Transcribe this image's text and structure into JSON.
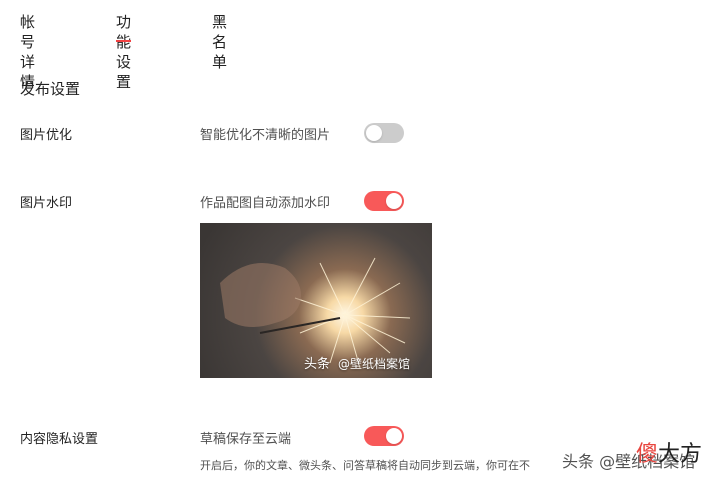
{
  "tabs": [
    {
      "label": "帐号详情",
      "active": false
    },
    {
      "label": "功能设置",
      "active": true
    },
    {
      "label": "黑名单",
      "active": false
    }
  ],
  "section": {
    "title": "发布设置"
  },
  "settings": [
    {
      "label": "图片优化",
      "description": "智能优化不清晰的图片",
      "enabled": false
    },
    {
      "label": "图片水印",
      "description": "作品配图自动添加水印",
      "enabled": true
    },
    {
      "label": "内容隐私设置",
      "description": "草稿保存至云端",
      "enabled": true
    }
  ],
  "watermark_preview": {
    "app": "头条",
    "handle": "@壁纸档案馆"
  },
  "privacy_note": "开启后，你的文章、微头条、问答草稿将自动同步到云端，你可在不",
  "overlay": {
    "watermark_text": "头条 @壁纸档案馆",
    "brand_1": "傻",
    "brand_2": "大方"
  },
  "colors": {
    "accent": "#f04142",
    "toggle_on": "#f85959",
    "toggle_off": "#cccccc"
  }
}
